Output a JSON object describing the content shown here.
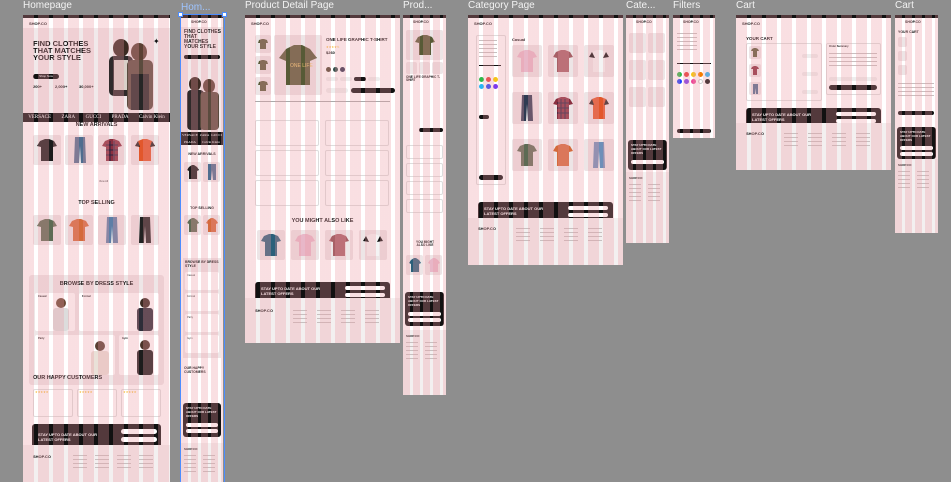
{
  "frames": {
    "homepage": {
      "label": "Homepage",
      "logo": "SHOP.CO",
      "hero_title": "FIND CLOTHES THAT MATCHES YOUR STYLE",
      "hero_cta": "Shop Now",
      "stats": [
        "200+",
        "2,000+",
        "30,000+"
      ],
      "brands": [
        "VERSACE",
        "ZARA",
        "GUCCI",
        "PRADA",
        "Calvin Klein"
      ],
      "new_arrivals": "NEW ARRIVALS",
      "top_selling": "TOP SELLING",
      "browse_title": "BROWSE BY DRESS STYLE",
      "styles": [
        "Casual",
        "Formal",
        "Party",
        "Gym"
      ],
      "customers_title": "OUR HAPPY CUSTOMERS",
      "newsletter": "STAY UPTO DATE ABOUT OUR LATEST OFFERS",
      "footer_logo": "SHOP.CO"
    },
    "homepage_mobile": {
      "label": "Hom...",
      "logo": "SHOP.CO",
      "hero_title": "FIND CLOTHES THAT MATCHES YOUR STYLE",
      "brands": [
        "VERSACE",
        "ZARA",
        "GUCCI",
        "PRADA",
        "Calvin Klein"
      ],
      "new_arrivals": "NEW ARRIVALS",
      "top_selling": "TOP SELLING",
      "browse_title": "BROWSE BY DRESS STYLE",
      "styles": [
        "Casual",
        "Formal",
        "Party",
        "Gym"
      ],
      "customers_title": "OUR HAPPY CUSTOMERS",
      "newsletter": "STAY UPTO DATE ABOUT OUR LATEST OFFERS",
      "footer_logo": "SHOP.CO"
    },
    "product_detail": {
      "label": "Product Detail Page",
      "logo": "SHOP.CO",
      "product_title": "ONE LIFE GRAPHIC T-SHIRT",
      "price": "$260",
      "also_like": "YOU MIGHT ALSO LIKE",
      "newsletter": "STAY UPTO DATE ABOUT OUR LATEST OFFERS",
      "footer_logo": "SHOP.CO"
    },
    "product_mobile": {
      "label": "Prod...",
      "logo": "SHOP.CO",
      "product_title": "ONE LIFE GRAPHIC T-SHIRT",
      "also_like": "YOU MIGHT ALSO LIKE",
      "newsletter": "STAY UPTO DATE ABOUT OUR LATEST OFFERS",
      "footer_logo": "SHOP.CO"
    },
    "category": {
      "label": "Category Page",
      "logo": "SHOP.CO",
      "category_title": "Casual",
      "newsletter": "STAY UPTO DATE ABOUT OUR LATEST OFFERS",
      "footer_logo": "SHOP.CO"
    },
    "category_mobile": {
      "label": "Cate...",
      "logo": "SHOP.CO",
      "newsletter": "STAY UPTO DATE ABOUT OUR LATEST OFFERS",
      "footer_logo": "SHOP.CO"
    },
    "filters": {
      "label": "Filters",
      "logo": "SHOP.CO"
    },
    "cart": {
      "label": "Cart",
      "logo": "SHOP.CO",
      "cart_title": "YOUR CART",
      "summary_title": "Order Summary",
      "newsletter": "STAY UPTO DATE ABOUT OUR LATEST OFFERS",
      "footer_logo": "SHOP.CO"
    },
    "cart_mobile": {
      "label": "Cart",
      "logo": "SHOP.CO",
      "cart_title": "YOUR CART",
      "newsletter": "STAY UPTO DATE ABOUT OUR LATEST OFFERS",
      "footer_logo": "SHOP.CO"
    }
  },
  "colors": {
    "canvas": "#8e8e8e",
    "grid": "#ec96a0",
    "selection": "#4c8dff",
    "ink": "#111111"
  },
  "swatch_colors": [
    "#2fb84a",
    "#e53935",
    "#f5c518",
    "#f57c00",
    "#29b6f6",
    "#1e40ff",
    "#7c3aed",
    "#ec4899",
    "#ffffff",
    "#111111"
  ]
}
